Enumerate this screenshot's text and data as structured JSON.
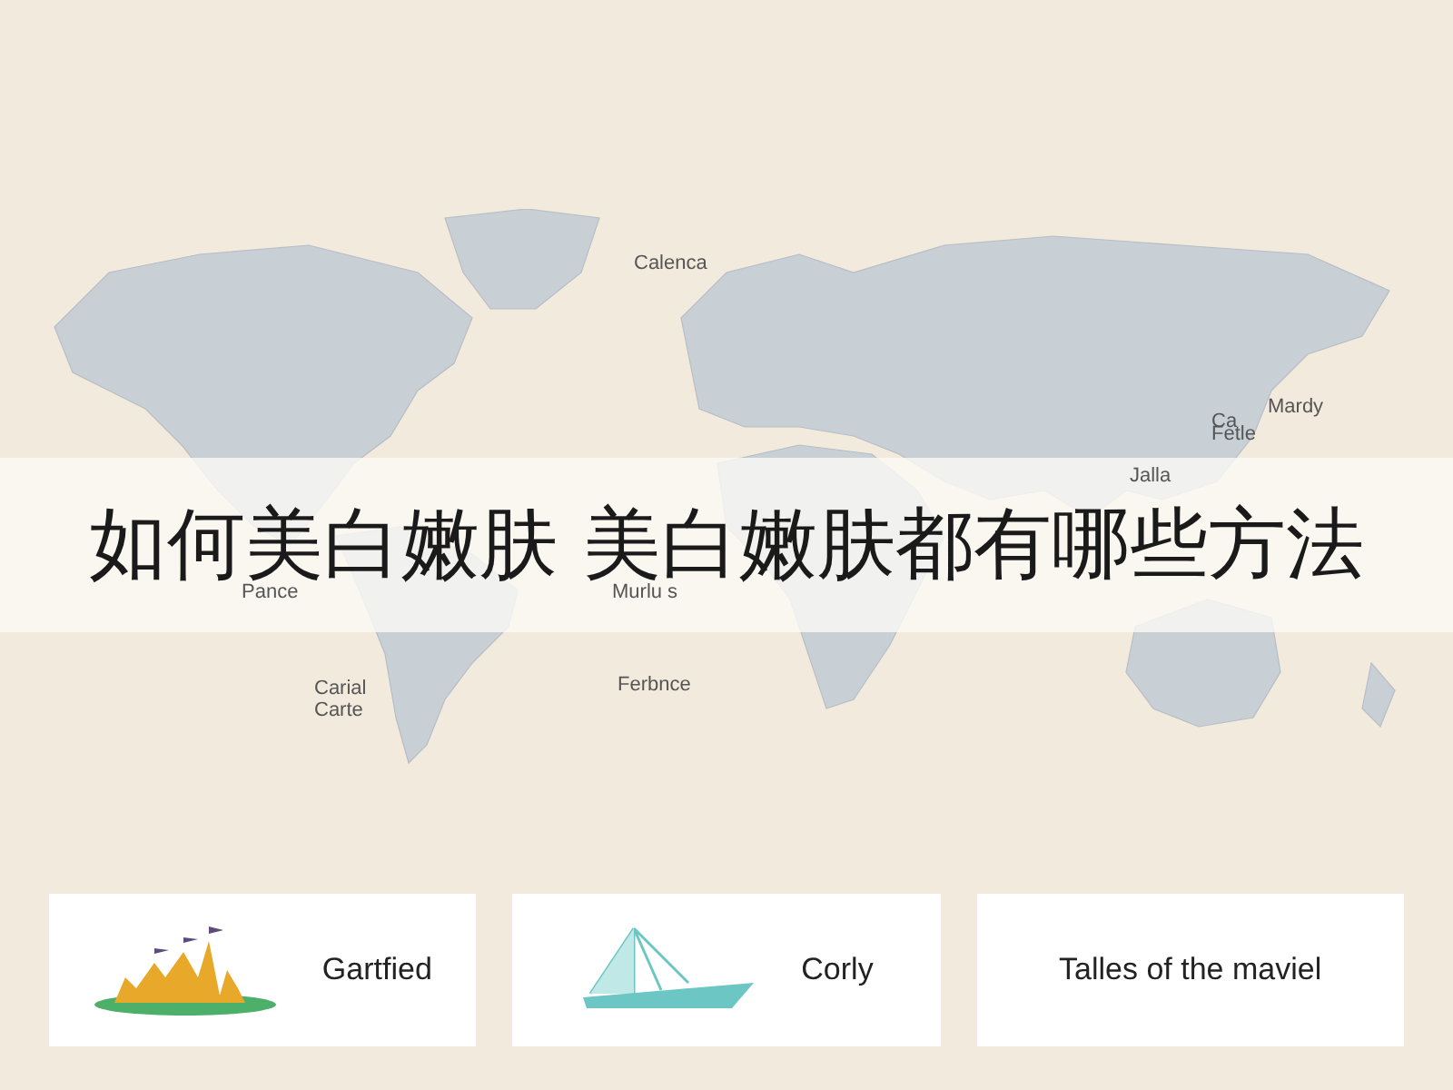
{
  "title": "如何美白嫩肤 美白嫩肤都有哪些方法",
  "map_labels": [
    {
      "text": "Calenca"
    },
    {
      "text": "Mardy"
    },
    {
      "text": "Ca"
    },
    {
      "text": "Fetle"
    },
    {
      "text": "Jalla"
    },
    {
      "text": "Pance"
    },
    {
      "text": "Murlu s"
    },
    {
      "text": "Carial"
    },
    {
      "text": "Carte"
    },
    {
      "text": "Ferbnce"
    }
  ],
  "cards": [
    {
      "kind": "castle",
      "label": "Gartfied"
    },
    {
      "kind": "boat",
      "label": "Corly"
    },
    {
      "kind": "text",
      "label": "Talles of the maviel"
    }
  ]
}
